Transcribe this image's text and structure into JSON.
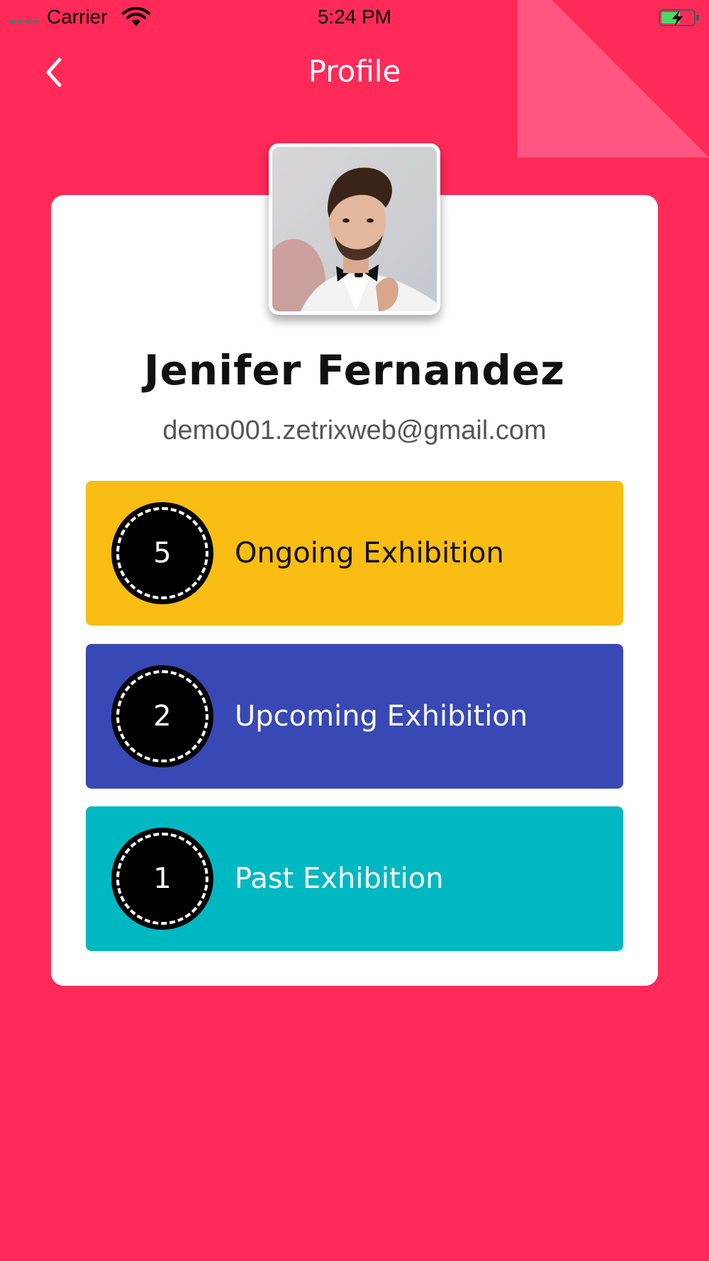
{
  "status_bar": {
    "carrier": "Carrier",
    "time": "5:24 PM"
  },
  "nav": {
    "title": "Profile",
    "back_icon": "chevron-left-icon"
  },
  "profile": {
    "name": "Jenifer Fernandez",
    "email": "demo001.zetrixweb@gmail.com",
    "avatar": "profile-photo"
  },
  "stats": [
    {
      "count": "5",
      "label": "Ongoing Exhibition",
      "color": "#F9BD14",
      "text_color": "#111111"
    },
    {
      "count": "2",
      "label": "Upcoming Exhibition",
      "color": "#3849B5",
      "text_color": "#FFFFFF"
    },
    {
      "count": "1",
      "label": "Past Exhibition",
      "color": "#00B8C1",
      "text_color": "#FFFFFF"
    }
  ],
  "colors": {
    "background": "#FF2A58",
    "corner_fold": "#FF5580",
    "card": "#FFFFFF"
  }
}
